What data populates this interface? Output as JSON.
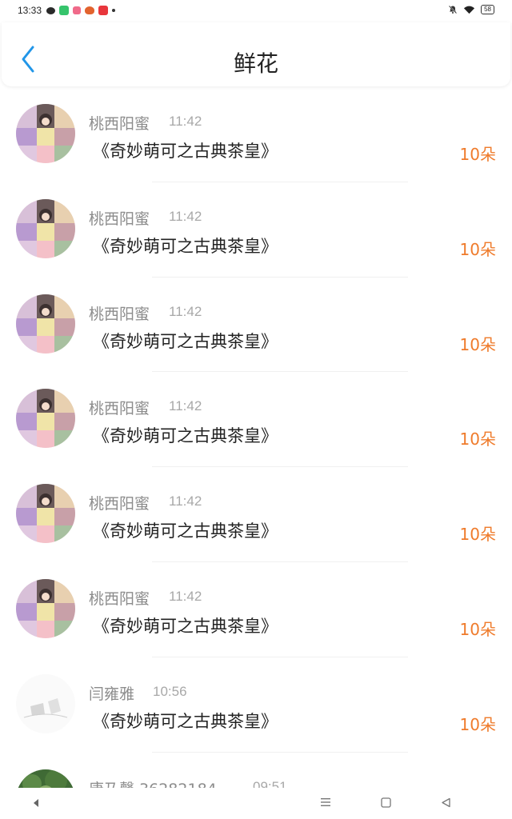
{
  "status_bar": {
    "time": "13:33",
    "battery": "58",
    "app_icons": [
      "wechat-icon",
      "green-app-icon",
      "pink-app-icon",
      "orange-app-icon",
      "red-app-icon",
      "dot-icon"
    ],
    "right_icons": [
      "bell-off-icon",
      "wifi-icon",
      "battery-icon"
    ]
  },
  "header": {
    "title": "鲜花",
    "back_icon": "chevron-left-icon"
  },
  "colors": {
    "accent_blue": "#2196e8",
    "count_orange": "#ef7b2b",
    "name_gray": "#8c8c8c",
    "time_gray": "#a8a8a8"
  },
  "records": [
    {
      "name": "桃西阳蜜",
      "time": "11:42",
      "gift": "《奇妙萌可之古典茶皇》",
      "count": "10朵",
      "avatar": "anime-avatar"
    },
    {
      "name": "桃西阳蜜",
      "time": "11:42",
      "gift": "《奇妙萌可之古典茶皇》",
      "count": "10朵",
      "avatar": "anime-avatar"
    },
    {
      "name": "桃西阳蜜",
      "time": "11:42",
      "gift": "《奇妙萌可之古典茶皇》",
      "count": "10朵",
      "avatar": "anime-avatar"
    },
    {
      "name": "桃西阳蜜",
      "time": "11:42",
      "gift": "《奇妙萌可之古典茶皇》",
      "count": "10朵",
      "avatar": "anime-avatar"
    },
    {
      "name": "桃西阳蜜",
      "time": "11:42",
      "gift": "《奇妙萌可之古典茶皇》",
      "count": "10朵",
      "avatar": "anime-avatar"
    },
    {
      "name": "桃西阳蜜",
      "time": "11:42",
      "gift": "《奇妙萌可之古典茶皇》",
      "count": "10朵",
      "avatar": "anime-avatar"
    },
    {
      "name": "闫雍雅",
      "time": "10:56",
      "gift": "《奇妙萌可之古典茶皇》",
      "count": "10朵",
      "avatar": "sketch-avatar"
    },
    {
      "name": "唐乃馨 36282184",
      "time": "09:51",
      "gift": "",
      "count": "",
      "avatar": "nature-avatar"
    }
  ],
  "nav_bar": {
    "icons": [
      "back-arrow-icon",
      "menu-icon",
      "home-square-icon",
      "back-triangle-icon"
    ]
  }
}
